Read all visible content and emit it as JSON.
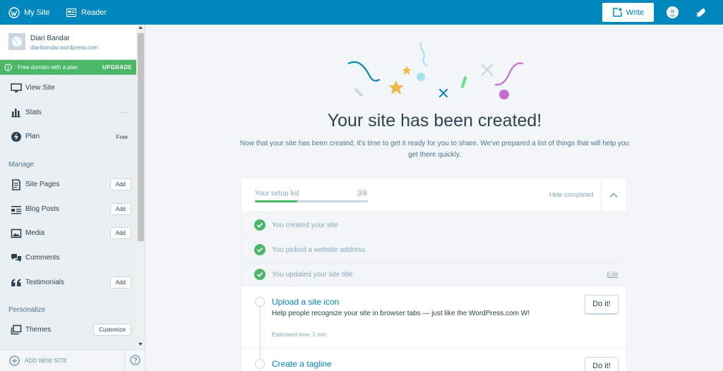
{
  "masterbar": {
    "my_site": "My Site",
    "reader": "Reader",
    "write": "Write"
  },
  "sidebar": {
    "site_title": "Diari Bandar",
    "site_domain": "diaribandar.wordpress.com",
    "upgrade_text": "Free domain with a plan",
    "upgrade_label": "UPGRADE",
    "view_site": "View Site",
    "stats": "Stats",
    "plan": "Plan",
    "plan_value": "Free",
    "manage_heading": "Manage",
    "site_pages": "Site Pages",
    "blog_posts": "Blog Posts",
    "media": "Media",
    "comments": "Comments",
    "testimonials": "Testimonials",
    "add_label": "Add",
    "personalize_heading": "Personalize",
    "themes": "Themes",
    "customize_label": "Customize",
    "add_new_site": "ADD NEW SITE"
  },
  "main": {
    "title": "Your site has been created!",
    "description": "Now that your site has been created, it's time to get it ready for you to share. We've prepared a list of things that will help you get there quickly.",
    "setup_list_label": "Your setup list",
    "setup_count": "3/8",
    "progress_fraction": 0.375,
    "hide_completed": "Hide completed",
    "completed_tasks": [
      {
        "label": "You created your site"
      },
      {
        "label": "You picked a website address"
      },
      {
        "label": "You updated your site title",
        "action": "Edit"
      }
    ],
    "todo_tasks": [
      {
        "title": "Upload a site icon",
        "description": "Help people recognize your site in browser tabs — just like the WordPress.com W!",
        "time": "Estimated time: 1 min",
        "button": "Do it!"
      },
      {
        "title": "Create a tagline",
        "button": "Do it!"
      }
    ]
  },
  "colors": {
    "masterbar": "#0087be",
    "upgrade": "#4ab866",
    "link": "#0087be",
    "check": "#4ab866"
  }
}
